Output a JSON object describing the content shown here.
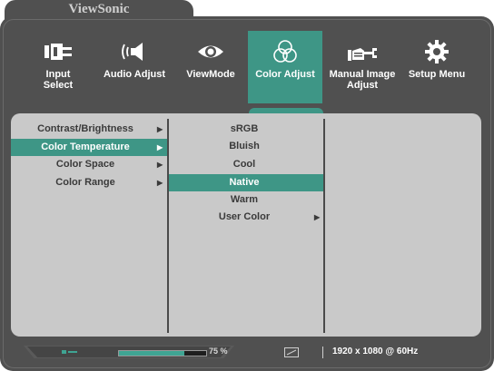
{
  "brand": "ViewSonic",
  "nav": [
    {
      "label": "Input\nSelect",
      "icon": "input-select-icon",
      "active": false
    },
    {
      "label": "Audio Adjust",
      "icon": "speaker-icon",
      "active": false
    },
    {
      "label": "ViewMode",
      "icon": "eye-icon",
      "active": false
    },
    {
      "label": "Color Adjust",
      "icon": "color-circles-icon",
      "active": true
    },
    {
      "label": "Manual Image\nAdjust",
      "icon": "hand-wrench-icon",
      "active": false
    },
    {
      "label": "Setup Menu",
      "icon": "gear-icon",
      "active": false
    }
  ],
  "menu": [
    {
      "label": "Contrast/Brightness",
      "selected": false
    },
    {
      "label": "Color Temperature",
      "selected": true
    },
    {
      "label": "Color Space",
      "selected": false
    },
    {
      "label": "Color Range",
      "selected": false
    }
  ],
  "submenu": [
    {
      "label": "sRGB",
      "selected": false,
      "has_submenu": false
    },
    {
      "label": "Bluish",
      "selected": false,
      "has_submenu": false
    },
    {
      "label": "Cool",
      "selected": false,
      "has_submenu": false
    },
    {
      "label": "Native",
      "selected": true,
      "has_submenu": false
    },
    {
      "label": "Warm",
      "selected": false,
      "has_submenu": false
    },
    {
      "label": "User Color",
      "selected": false,
      "has_submenu": true
    }
  ],
  "status": {
    "volume_percent": 75,
    "volume_text": "75 %",
    "resolution": "1920 x 1080 @ 60Hz"
  },
  "colors": {
    "accent": "#3e9686",
    "frame": "#505050",
    "panel": "#c9c9c9"
  }
}
